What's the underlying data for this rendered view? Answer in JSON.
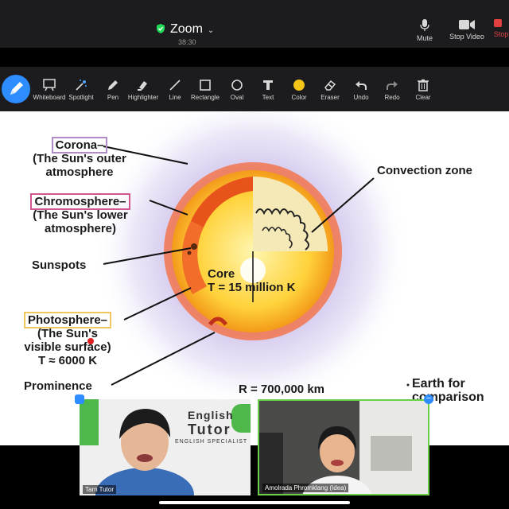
{
  "app": {
    "title": "Zoom",
    "timer": "38:30"
  },
  "top_controls": {
    "mute": "Mute",
    "stop_video": "Stop Video",
    "stop_share": "Stop"
  },
  "annotation_tools": [
    "Whiteboard",
    "Spotlight",
    "Pen",
    "Highlighter",
    "Line",
    "Rectangle",
    "Oval",
    "Text",
    "Color",
    "Eraser",
    "Undo",
    "Redo",
    "Clear"
  ],
  "icons": {
    "pen_main": "pen-icon",
    "secure": "shield-check-icon"
  },
  "colors": {
    "accent": "#2d8cff",
    "secure_green": "#23d959",
    "stop_red": "#e04040",
    "color_swatch": "#f5c518",
    "active_speaker": "#6ad04a"
  },
  "diagram": {
    "corona_title": "Corona–",
    "corona_line1": "(The Sun's outer",
    "corona_line2": "atmosphere",
    "chromo_title": "Chromosphere–",
    "chromo_line1": "(The Sun's lower",
    "chromo_line2": "atmosphere)",
    "sunspots": "Sunspots",
    "photo_title": "Photosphere–",
    "photo_line1": "(The Sun's",
    "photo_line2": "visible surface)",
    "photo_temp": "T ≈ 6000 K",
    "prominence": "Prominence",
    "convection": "Convection zone",
    "core": "Core",
    "core_temp": "T = 15 million K",
    "radius": "R = 700,000 km",
    "earth1": "Earth for",
    "earth2": "comparison"
  },
  "participants": [
    {
      "name": "Tarn Tutor",
      "bg_line1": "English",
      "bg_line2": "Tutor",
      "bg_line3": "ENGLISH SPECIALIST"
    },
    {
      "name": "Amolrada Phromklang (Idea)"
    }
  ]
}
